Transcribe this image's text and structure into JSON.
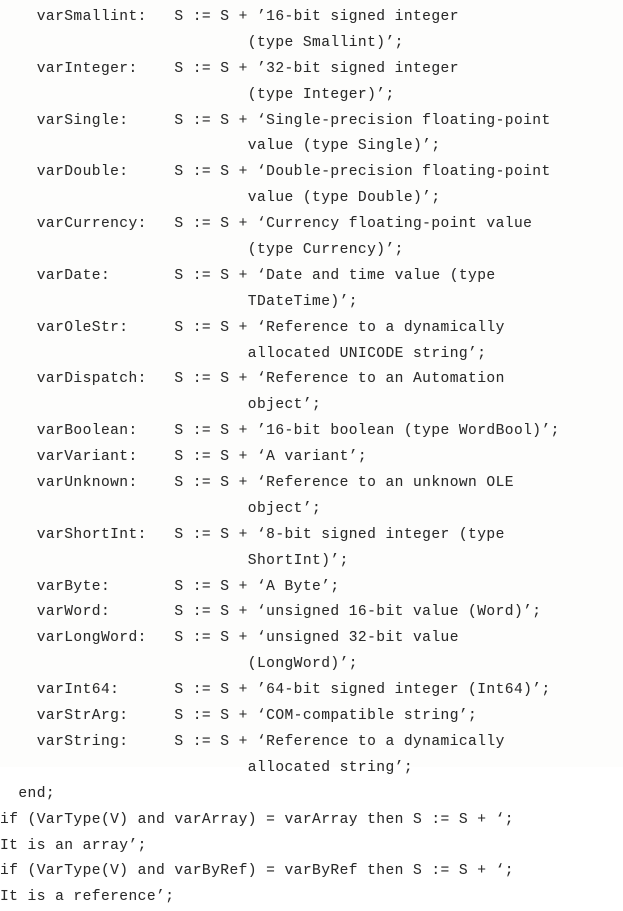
{
  "document": {
    "kind": "scanned-code-listing",
    "language": "Delphi / Object Pascal",
    "background_color": "#fdfdfc",
    "text_color": "#2a2a2a",
    "open_quote": "‘",
    "close_quote": "’"
  },
  "code": {
    "lines": [
      "    varSmallint:   S := S + ’16-bit signed integer",
      "                           (type Smallint)’;",
      "    varInteger:    S := S + ’32-bit signed integer",
      "                           (type Integer)’;",
      "    varSingle:     S := S + ‘Single-precision floating-point",
      "                           value (type Single)’;",
      "    varDouble:     S := S + ‘Double-precision floating-point",
      "                           value (type Double)’;",
      "    varCurrency:   S := S + ‘Currency floating-point value",
      "                           (type Currency)’;",
      "    varDate:       S := S + ‘Date and time value (type",
      "                           TDateTime)’;",
      "    varOleStr:     S := S + ‘Reference to a dynamically",
      "                           allocated UNICODE string’;",
      "    varDispatch:   S := S + ‘Reference to an Automation",
      "                           object’;",
      "    varBoolean:    S := S + ’16-bit boolean (type WordBool)’;",
      "    varVariant:    S := S + ‘A variant’;",
      "    varUnknown:    S := S + ‘Reference to an unknown OLE",
      "                           object’;",
      "    varShortInt:   S := S + ‘8-bit signed integer (type",
      "                           ShortInt)’;",
      "    varByte:       S := S + ‘A Byte’;",
      "    varWord:       S := S + ‘unsigned 16-bit value (Word)’;",
      "    varLongWord:   S := S + ‘unsigned 32-bit value",
      "                           (LongWord)’;",
      "    varInt64:      S := S + ’64-bit signed integer (Int64)’;",
      "    varStrArg:     S := S + ‘COM-compatible string’;",
      "    varString:     S := S + ‘Reference to a dynamically",
      "                           allocated string’;",
      "  end;",
      "if (VarType(V) and varArray) = varArray then S := S + ‘;",
      "It is an array’;",
      "if (VarType(V) and varByRef) = varByRef then S := S + ‘;",
      "It is a reference’;"
    ],
    "entries": [
      {
        "name": "varSmallint:",
        "assign": "S := S +",
        "text": "16-bit signed integer (type Smallint)"
      },
      {
        "name": "varInteger:",
        "assign": "S := S +",
        "text": "32-bit signed integer (type Integer)"
      },
      {
        "name": "varSingle:",
        "assign": "S := S +",
        "text": "Single-precision floating-point value (type Single)"
      },
      {
        "name": "varDouble:",
        "assign": "S := S +",
        "text": "Double-precision floating-point value (type Double)"
      },
      {
        "name": "varCurrency:",
        "assign": "S := S +",
        "text": "Currency floating-point value (type Currency)"
      },
      {
        "name": "varDate:",
        "assign": "S := S +",
        "text": "Date and time value (type TDateTime)"
      },
      {
        "name": "varOleStr:",
        "assign": "S := S +",
        "text": "Reference to a dynamically allocated UNICODE string"
      },
      {
        "name": "varDispatch:",
        "assign": "S := S +",
        "text": "Reference to an Automation object"
      },
      {
        "name": "varBoolean:",
        "assign": "S := S +",
        "text": "16-bit boolean (type WordBool)"
      },
      {
        "name": "varVariant:",
        "assign": "S := S +",
        "text": "A variant"
      },
      {
        "name": "varUnknown:",
        "assign": "S := S +",
        "text": "Reference to an unknown OLE object"
      },
      {
        "name": "varShortInt:",
        "assign": "S := S +",
        "text": "8-bit signed integer (type ShortInt)"
      },
      {
        "name": "varByte:",
        "assign": "S := S +",
        "text": "A Byte"
      },
      {
        "name": "varWord:",
        "assign": "S := S +",
        "text": "unsigned 16-bit value (Word)"
      },
      {
        "name": "varLongWord:",
        "assign": "S := S +",
        "text": "unsigned 32-bit value (LongWord)"
      },
      {
        "name": "varInt64:",
        "assign": "S := S +",
        "text": "64-bit signed integer (Int64)"
      },
      {
        "name": "varStrArg:",
        "assign": "S := S +",
        "text": "COM-compatible string"
      },
      {
        "name": "varString:",
        "assign": "S := S +",
        "text": "Reference to a dynamically allocated string"
      }
    ],
    "trailing": {
      "end_statement": "end;",
      "if_array": "if (VarType(V) and varArray) = varArray then S := S + ‘;",
      "if_array_text": "It is an array’;",
      "if_byref": "if (VarType(V) and varByRef) = varByRef then S := S + ‘;",
      "if_byref_text": "It is a reference’;"
    }
  }
}
